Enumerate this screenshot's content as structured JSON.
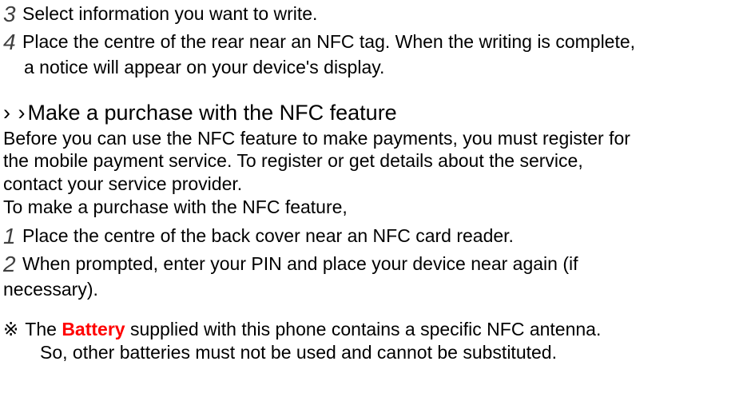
{
  "steps_a": {
    "s3": {
      "num": "3",
      "text": "Select information you want to write."
    },
    "s4": {
      "num": "4",
      "text": "Place the centre of the rear near an NFC tag. When the writing is complete,"
    },
    "s4_cont": "a notice will appear on your device's display."
  },
  "section": {
    "arrows": "› ›",
    "title": "Make a purchase with the NFC feature"
  },
  "intro": {
    "l1": "Before you can use the NFC feature to make payments, you must register for",
    "l2": "the mobile payment service. To register or get details about the service,",
    "l3": "contact your service provider.",
    "l4": "To make a purchase with the NFC feature,"
  },
  "steps_b": {
    "s1": {
      "num": "1",
      "text": "Place the centre of the back cover near an NFC card reader."
    },
    "s2": {
      "num": "2",
      "text": "When prompted, enter your PIN and place your device near again (if"
    },
    "s2_cont": "necessary)."
  },
  "note": {
    "mark": "※",
    "pre": " The ",
    "battery": "Battery",
    "post": " supplied with this phone contains a specific NFC antenna.",
    "l2": "So, other batteries must not be used and cannot be substituted."
  }
}
